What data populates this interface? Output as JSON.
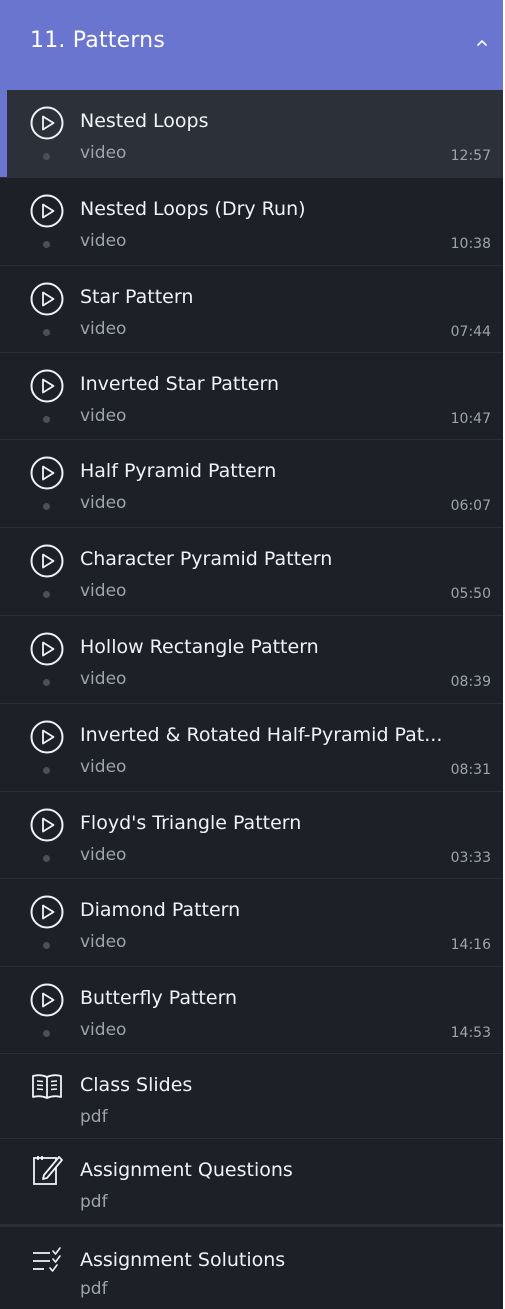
{
  "section": {
    "title": "11. Patterns",
    "collapse_icon": "chevron-up-icon",
    "colors": {
      "header_bg": "#6a75cf",
      "panel_bg": "#1e2027",
      "active_bg": "#2c3039",
      "active_accent": "#6a75cf"
    }
  },
  "items": [
    {
      "title": "Nested Loops",
      "type": "video",
      "duration": "12:57",
      "icon": "play-circle-icon",
      "active": true
    },
    {
      "title": "Nested Loops (Dry Run)",
      "type": "video",
      "duration": "10:38",
      "icon": "play-circle-icon"
    },
    {
      "title": "Star Pattern",
      "type": "video",
      "duration": "07:44",
      "icon": "play-circle-icon"
    },
    {
      "title": "Inverted Star Pattern",
      "type": "video",
      "duration": "10:47",
      "icon": "play-circle-icon"
    },
    {
      "title": "Half Pyramid Pattern",
      "type": "video",
      "duration": "06:07",
      "icon": "play-circle-icon"
    },
    {
      "title": "Character Pyramid Pattern",
      "type": "video",
      "duration": "05:50",
      "icon": "play-circle-icon"
    },
    {
      "title": "Hollow Rectangle Pattern",
      "type": "video",
      "duration": "08:39",
      "icon": "play-circle-icon"
    },
    {
      "title": "Inverted & Rotated Half-Pyramid Pat...",
      "type": "video",
      "duration": "08:31",
      "icon": "play-circle-icon"
    },
    {
      "title": "Floyd's Triangle Pattern",
      "type": "video",
      "duration": "03:33",
      "icon": "play-circle-icon"
    },
    {
      "title": "Diamond Pattern",
      "type": "video",
      "duration": "14:16",
      "icon": "play-circle-icon"
    },
    {
      "title": "Butterfly Pattern",
      "type": "video",
      "duration": "14:53",
      "icon": "play-circle-icon"
    },
    {
      "title": "Class Slides",
      "type": "pdf",
      "icon": "book-open-icon"
    },
    {
      "title": " Assignment Questions",
      "type": "pdf",
      "icon": "edit-note-icon"
    },
    {
      "title": "Assignment Solutions",
      "type": "pdf",
      "icon": "checklist-icon"
    }
  ]
}
